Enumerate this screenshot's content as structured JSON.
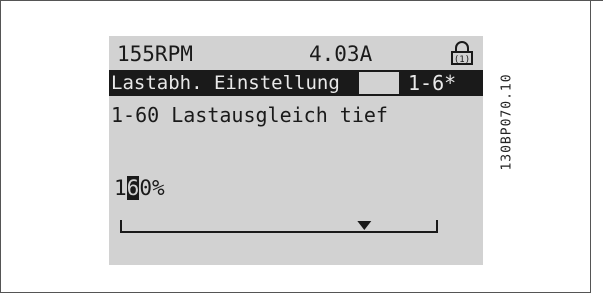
{
  "display": {
    "speed": "155RPM",
    "current": "4.03A",
    "menu_title": "Lastabh. Einstellung",
    "group_id": "1-6*",
    "parameter_name": "1-60 Lastausgleich tief",
    "value_prefix": "1",
    "value_cursor_digit": "6",
    "value_suffix": "0%",
    "slider_position": 0.77
  },
  "drawing_code": "130BP070.10",
  "colors": {
    "lcd_background": "#d2d2d2",
    "lcd_foreground": "#1a1a1a"
  },
  "icons": {
    "lock": "lock-icon"
  }
}
